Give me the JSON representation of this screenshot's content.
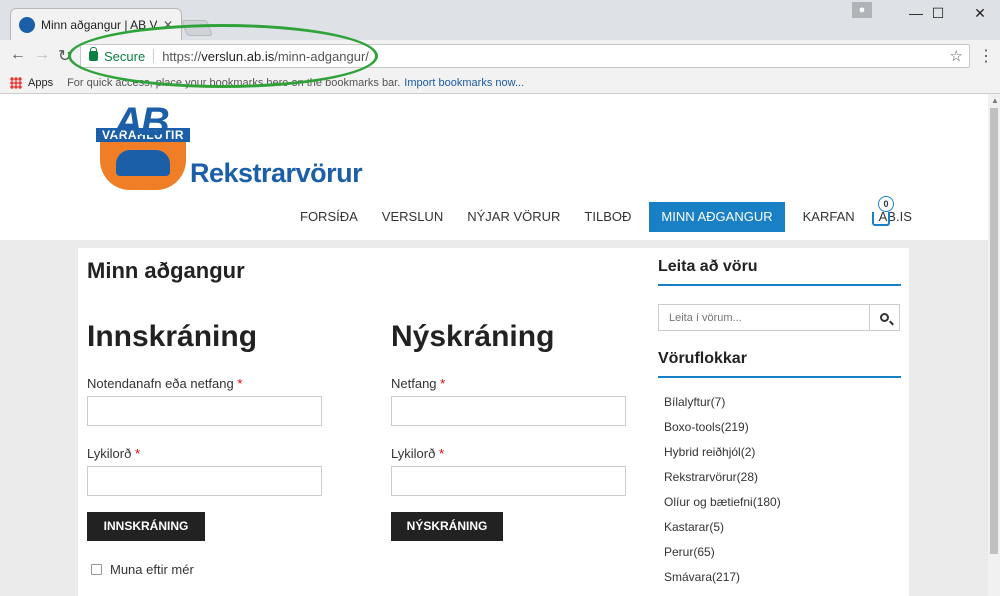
{
  "browser": {
    "tab_title": "Minn aðgangur | AB Vara",
    "secure_label": "Secure",
    "url_scheme": "https://",
    "url_host": "verslun.ab.is",
    "url_path": "/minn-adgangur/",
    "bookmarks": {
      "apps_label": "Apps",
      "hint": "For quick access, place your bookmarks here on the bookmarks bar.",
      "import_link": "Import bookmarks now..."
    }
  },
  "logo": {
    "ab": "AB",
    "band": "VARAHLUTIR",
    "text": "Rekstrarvörur"
  },
  "nav": {
    "items": [
      "FORSÍÐA",
      "VERSLUN",
      "NÝJAR VÖRUR",
      "TILBOÐ",
      "MINN AÐGANGUR",
      "KARFAN",
      "AB.IS"
    ],
    "active_index": 4,
    "cart_count": "0"
  },
  "account": {
    "page_title": "Minn aðgangur",
    "login": {
      "title": "Innskráning",
      "username_label": "Notendanafn eða netfang",
      "password_label": "Lykilorð",
      "required_mark": "*",
      "button": "INNSKRÁNING",
      "remember": "Muna eftir mér"
    },
    "register": {
      "title": "Nýskráning",
      "email_label": "Netfang",
      "password_label": "Lykilorð",
      "required_mark": "*",
      "button": "NÝSKRÁNING"
    }
  },
  "sidebar": {
    "search_heading": "Leita að vöru",
    "search_placeholder": "Leita í vörum...",
    "categories_heading": "Vöruflokkar",
    "categories": [
      "Bílalyftur(7)",
      "Boxo-tools(219)",
      "Hybrid reiðhjól(2)",
      "Rekstrarvörur(28)",
      "Olíur og bætiefni(180)",
      "Kastarar(5)",
      "Perur(65)",
      "Smávara(217)"
    ]
  },
  "colors": {
    "brand_blue": "#1b5fa8",
    "nav_active": "#1a80c6",
    "secure_green": "#0b8043",
    "highlight_green": "#2fa33a"
  }
}
